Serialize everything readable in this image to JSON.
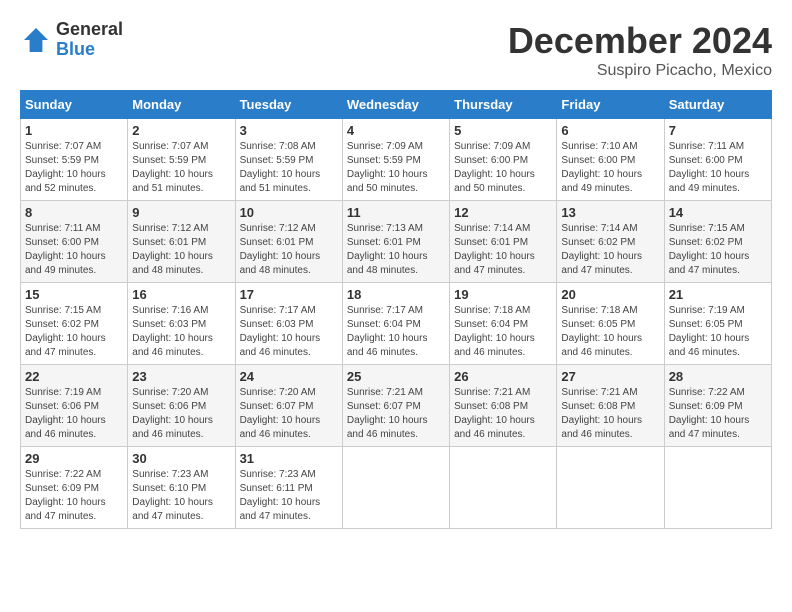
{
  "header": {
    "logo_general": "General",
    "logo_blue": "Blue",
    "month_title": "December 2024",
    "location": "Suspiro Picacho, Mexico"
  },
  "weekdays": [
    "Sunday",
    "Monday",
    "Tuesday",
    "Wednesday",
    "Thursday",
    "Friday",
    "Saturday"
  ],
  "weeks": [
    [
      {
        "day": "1",
        "sunrise": "Sunrise: 7:07 AM",
        "sunset": "Sunset: 5:59 PM",
        "daylight": "Daylight: 10 hours and 52 minutes."
      },
      {
        "day": "2",
        "sunrise": "Sunrise: 7:07 AM",
        "sunset": "Sunset: 5:59 PM",
        "daylight": "Daylight: 10 hours and 51 minutes."
      },
      {
        "day": "3",
        "sunrise": "Sunrise: 7:08 AM",
        "sunset": "Sunset: 5:59 PM",
        "daylight": "Daylight: 10 hours and 51 minutes."
      },
      {
        "day": "4",
        "sunrise": "Sunrise: 7:09 AM",
        "sunset": "Sunset: 5:59 PM",
        "daylight": "Daylight: 10 hours and 50 minutes."
      },
      {
        "day": "5",
        "sunrise": "Sunrise: 7:09 AM",
        "sunset": "Sunset: 6:00 PM",
        "daylight": "Daylight: 10 hours and 50 minutes."
      },
      {
        "day": "6",
        "sunrise": "Sunrise: 7:10 AM",
        "sunset": "Sunset: 6:00 PM",
        "daylight": "Daylight: 10 hours and 49 minutes."
      },
      {
        "day": "7",
        "sunrise": "Sunrise: 7:11 AM",
        "sunset": "Sunset: 6:00 PM",
        "daylight": "Daylight: 10 hours and 49 minutes."
      }
    ],
    [
      {
        "day": "8",
        "sunrise": "Sunrise: 7:11 AM",
        "sunset": "Sunset: 6:00 PM",
        "daylight": "Daylight: 10 hours and 49 minutes."
      },
      {
        "day": "9",
        "sunrise": "Sunrise: 7:12 AM",
        "sunset": "Sunset: 6:01 PM",
        "daylight": "Daylight: 10 hours and 48 minutes."
      },
      {
        "day": "10",
        "sunrise": "Sunrise: 7:12 AM",
        "sunset": "Sunset: 6:01 PM",
        "daylight": "Daylight: 10 hours and 48 minutes."
      },
      {
        "day": "11",
        "sunrise": "Sunrise: 7:13 AM",
        "sunset": "Sunset: 6:01 PM",
        "daylight": "Daylight: 10 hours and 48 minutes."
      },
      {
        "day": "12",
        "sunrise": "Sunrise: 7:14 AM",
        "sunset": "Sunset: 6:01 PM",
        "daylight": "Daylight: 10 hours and 47 minutes."
      },
      {
        "day": "13",
        "sunrise": "Sunrise: 7:14 AM",
        "sunset": "Sunset: 6:02 PM",
        "daylight": "Daylight: 10 hours and 47 minutes."
      },
      {
        "day": "14",
        "sunrise": "Sunrise: 7:15 AM",
        "sunset": "Sunset: 6:02 PM",
        "daylight": "Daylight: 10 hours and 47 minutes."
      }
    ],
    [
      {
        "day": "15",
        "sunrise": "Sunrise: 7:15 AM",
        "sunset": "Sunset: 6:02 PM",
        "daylight": "Daylight: 10 hours and 47 minutes."
      },
      {
        "day": "16",
        "sunrise": "Sunrise: 7:16 AM",
        "sunset": "Sunset: 6:03 PM",
        "daylight": "Daylight: 10 hours and 46 minutes."
      },
      {
        "day": "17",
        "sunrise": "Sunrise: 7:17 AM",
        "sunset": "Sunset: 6:03 PM",
        "daylight": "Daylight: 10 hours and 46 minutes."
      },
      {
        "day": "18",
        "sunrise": "Sunrise: 7:17 AM",
        "sunset": "Sunset: 6:04 PM",
        "daylight": "Daylight: 10 hours and 46 minutes."
      },
      {
        "day": "19",
        "sunrise": "Sunrise: 7:18 AM",
        "sunset": "Sunset: 6:04 PM",
        "daylight": "Daylight: 10 hours and 46 minutes."
      },
      {
        "day": "20",
        "sunrise": "Sunrise: 7:18 AM",
        "sunset": "Sunset: 6:05 PM",
        "daylight": "Daylight: 10 hours and 46 minutes."
      },
      {
        "day": "21",
        "sunrise": "Sunrise: 7:19 AM",
        "sunset": "Sunset: 6:05 PM",
        "daylight": "Daylight: 10 hours and 46 minutes."
      }
    ],
    [
      {
        "day": "22",
        "sunrise": "Sunrise: 7:19 AM",
        "sunset": "Sunset: 6:06 PM",
        "daylight": "Daylight: 10 hours and 46 minutes."
      },
      {
        "day": "23",
        "sunrise": "Sunrise: 7:20 AM",
        "sunset": "Sunset: 6:06 PM",
        "daylight": "Daylight: 10 hours and 46 minutes."
      },
      {
        "day": "24",
        "sunrise": "Sunrise: 7:20 AM",
        "sunset": "Sunset: 6:07 PM",
        "daylight": "Daylight: 10 hours and 46 minutes."
      },
      {
        "day": "25",
        "sunrise": "Sunrise: 7:21 AM",
        "sunset": "Sunset: 6:07 PM",
        "daylight": "Daylight: 10 hours and 46 minutes."
      },
      {
        "day": "26",
        "sunrise": "Sunrise: 7:21 AM",
        "sunset": "Sunset: 6:08 PM",
        "daylight": "Daylight: 10 hours and 46 minutes."
      },
      {
        "day": "27",
        "sunrise": "Sunrise: 7:21 AM",
        "sunset": "Sunset: 6:08 PM",
        "daylight": "Daylight: 10 hours and 46 minutes."
      },
      {
        "day": "28",
        "sunrise": "Sunrise: 7:22 AM",
        "sunset": "Sunset: 6:09 PM",
        "daylight": "Daylight: 10 hours and 47 minutes."
      }
    ],
    [
      {
        "day": "29",
        "sunrise": "Sunrise: 7:22 AM",
        "sunset": "Sunset: 6:09 PM",
        "daylight": "Daylight: 10 hours and 47 minutes."
      },
      {
        "day": "30",
        "sunrise": "Sunrise: 7:23 AM",
        "sunset": "Sunset: 6:10 PM",
        "daylight": "Daylight: 10 hours and 47 minutes."
      },
      {
        "day": "31",
        "sunrise": "Sunrise: 7:23 AM",
        "sunset": "Sunset: 6:11 PM",
        "daylight": "Daylight: 10 hours and 47 minutes."
      },
      null,
      null,
      null,
      null
    ]
  ]
}
